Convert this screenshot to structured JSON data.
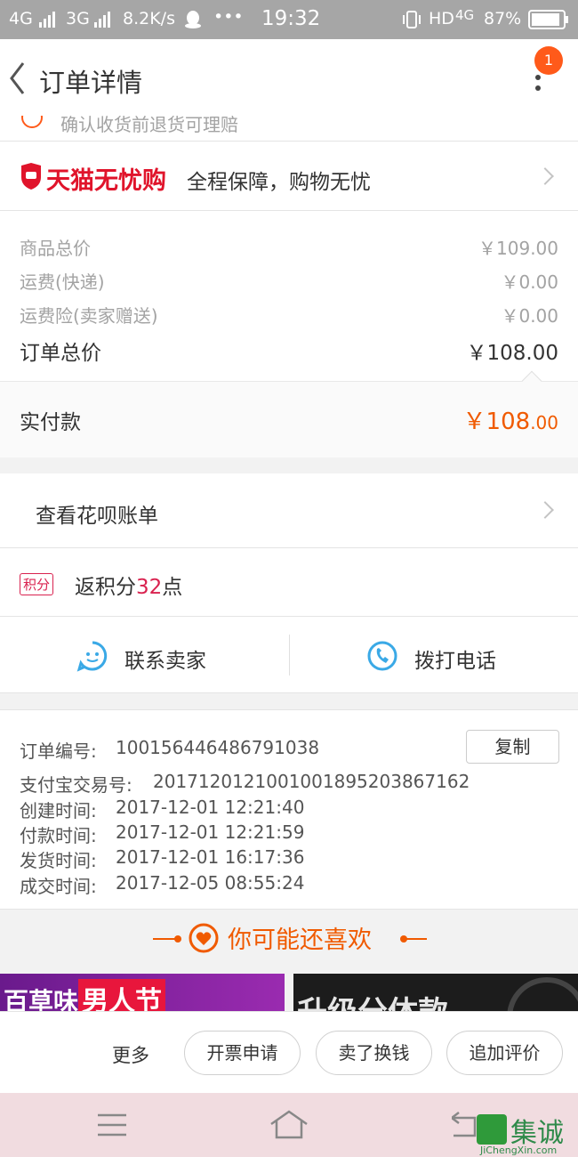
{
  "status_bar": {
    "net1": "4G",
    "net2": "3G",
    "speed": "8.2K/s",
    "dots": "•••",
    "time": "19:32",
    "hd": "HD",
    "net3": "4G",
    "battery": "87%"
  },
  "header": {
    "title": "订单详情",
    "badge": "1"
  },
  "partial_text": "确认收货前退货可理赔",
  "tmall": {
    "brand": "天猫无忧购",
    "slogan": "全程保障，购物无忧"
  },
  "costs": [
    {
      "label": "商品总价",
      "value": "￥109.00"
    },
    {
      "label": "运费(快递)",
      "value": "￥0.00"
    },
    {
      "label": "运费险(卖家赠送)",
      "value": "￥0.00"
    }
  ],
  "order_total": {
    "label": "订单总价",
    "value": "￥108.00"
  },
  "paid": {
    "label": "实付款",
    "int": "￥108",
    "dec": ".00"
  },
  "huabei": "查看花呗账单",
  "points": {
    "tag": "积分",
    "pre": "返积分",
    "num": "32",
    "post": "点"
  },
  "contact": {
    "seller": "联系卖家",
    "phone": "拨打电话"
  },
  "info": {
    "order_no_label": "订单编号:",
    "order_no": "100156446486791038",
    "copy": "复制",
    "alipay_label": "支付宝交易号:",
    "alipay": "20171201210010018952038671​62",
    "rows": [
      {
        "label": "创建时间:",
        "value": "2017-12-01 12:21:40"
      },
      {
        "label": "付款时间:",
        "value": "2017-12-01 12:21:59"
      },
      {
        "label": "发货时间:",
        "value": "2017-12-01 16:17:36"
      },
      {
        "label": "成交时间:",
        "value": "2017-12-05 08:55:24"
      }
    ]
  },
  "recommend": {
    "title": "你可能还喜欢",
    "banner1_a": "百草味",
    "banner1_b": "男人节",
    "banner2": "升级分体款"
  },
  "actions": {
    "more": "更多",
    "invoice": "开票申请",
    "sell": "卖了换钱",
    "review": "追加评价"
  },
  "watermark": {
    "main": "集诚信",
    "sub": "JiChengXin.com"
  },
  "colors": {
    "accent": "#ff5000",
    "price": "#f05a00",
    "points": "#d9224f",
    "icon_blue": "#3aa9e6",
    "brand_red": "#e0142b"
  }
}
